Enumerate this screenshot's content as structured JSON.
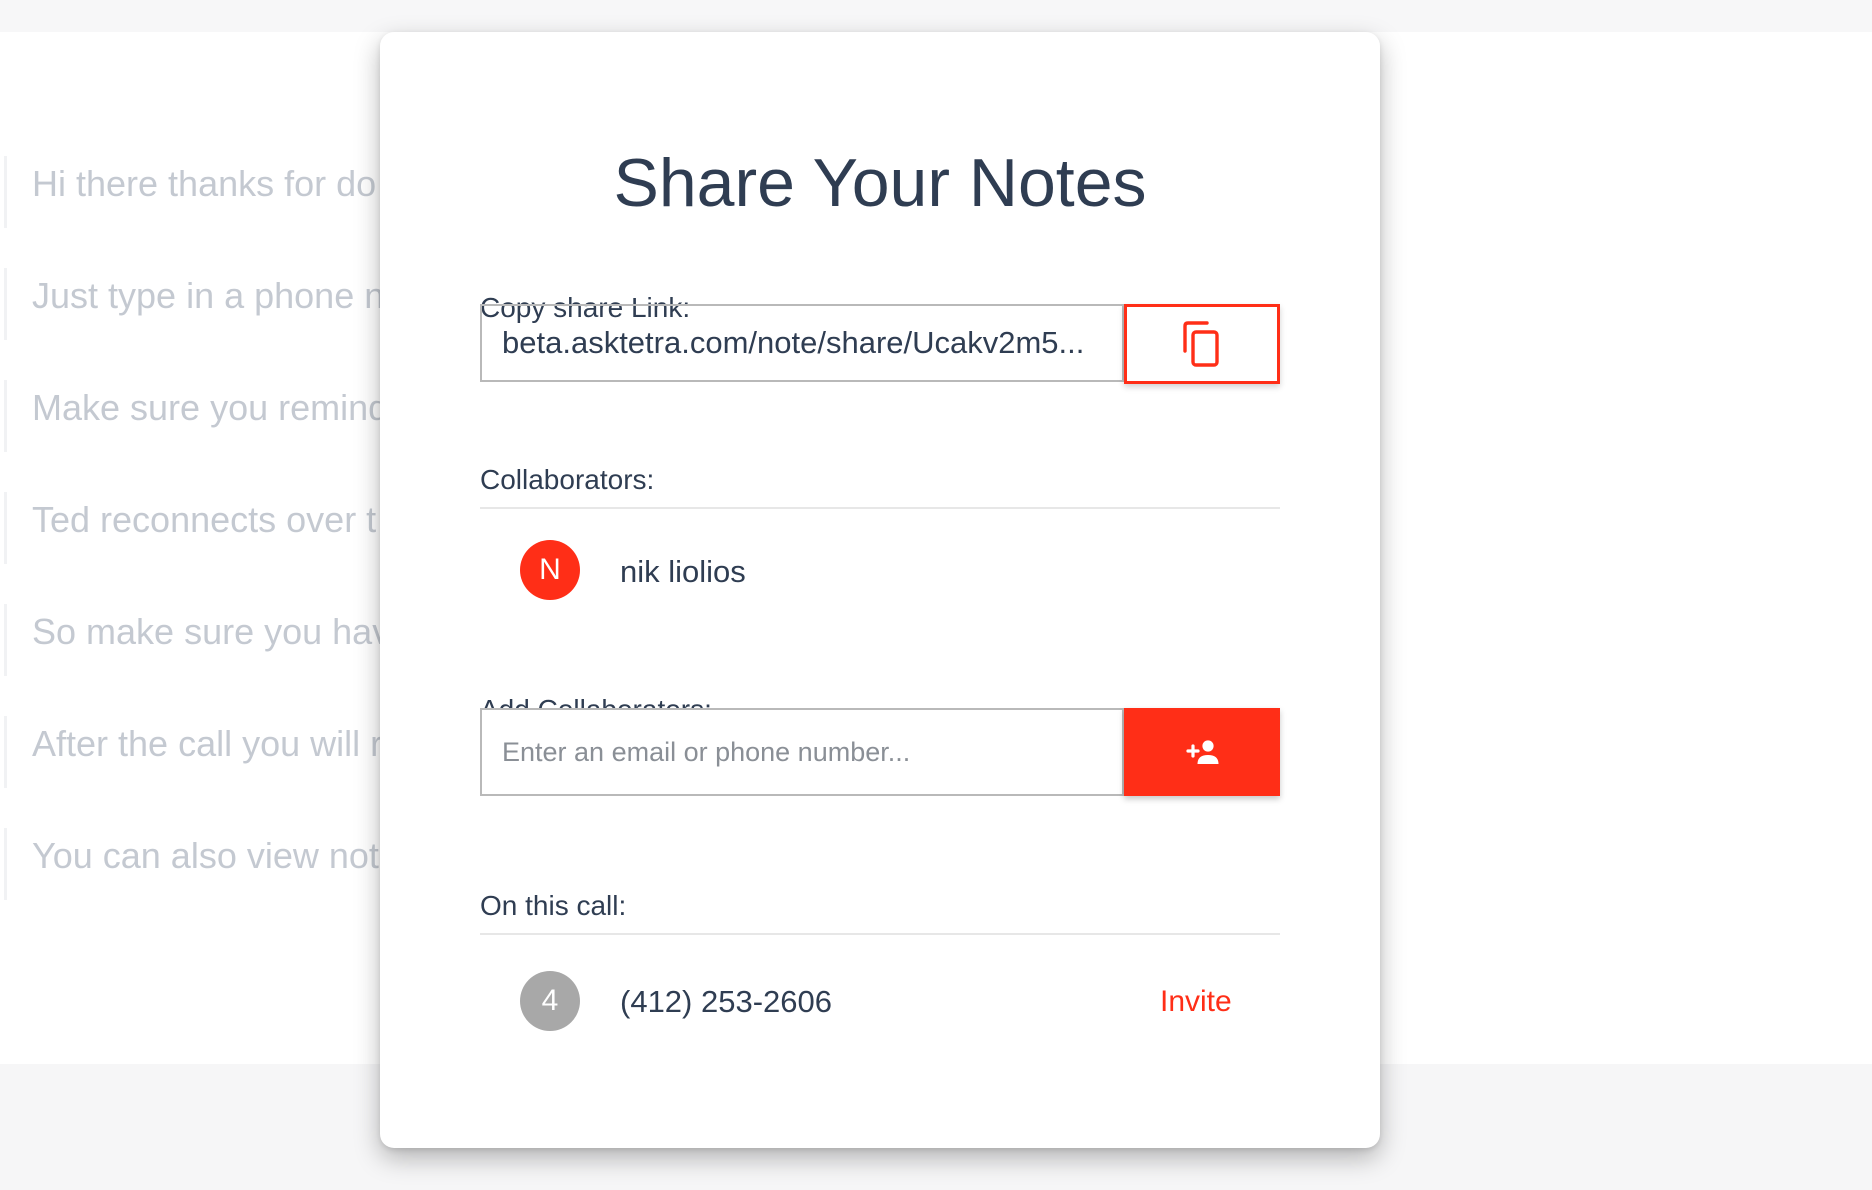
{
  "background_notes": [
    "Hi there thanks for do",
    "Just type in a phone n",
    "Make sure you remind",
    "Ted reconnects over t",
    "So make sure you hav",
    "After the call you will r",
    "You can also view not"
  ],
  "modal": {
    "title": "Share Your Notes",
    "share_link": {
      "label": "Copy share Link:",
      "value": "beta.asktetra.com/note/share/Ucakv2m5...",
      "copy_icon": "copy-icon"
    },
    "collaborators": {
      "label": "Collaborators:",
      "items": [
        {
          "initial": "N",
          "name": "nik liolios"
        }
      ]
    },
    "add_collaborators": {
      "label": "Add Collaborators:",
      "placeholder": "Enter an email or phone number...",
      "button_icon": "add-person-icon"
    },
    "on_this_call": {
      "label": "On this call:",
      "items": [
        {
          "initial": "4",
          "number": "(412) 253-2606",
          "action": "Invite"
        }
      ]
    }
  },
  "colors": {
    "accent": "#ff2e17",
    "text": "#2f3d52",
    "muted_text": "#c4c9d1",
    "grey_avatar": "#a8a8a8"
  }
}
